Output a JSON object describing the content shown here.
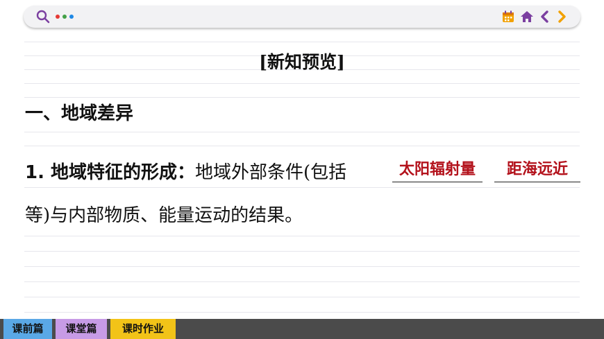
{
  "header": {
    "icons": [
      "search-icon",
      "more-dots-icon",
      "calendar-icon",
      "home-icon",
      "chevron-left-icon",
      "chevron-right-icon"
    ],
    "dot_colors": [
      "#e53935",
      "#43a047",
      "#1e88e5"
    ]
  },
  "content": {
    "section_title": "[新知预览]",
    "heading": "一、地域差异",
    "item1_lead": "1. 地域特征的形成：",
    "item1_text": "地域外部条件(包括",
    "blank1": "太阳辐射量",
    "blank2": "距海远近",
    "item1_cont": "等)与内部物质、能量运动的结果。"
  },
  "footer": {
    "tabs": [
      {
        "label": "课前篇",
        "color": "#5aa8e6"
      },
      {
        "label": "课堂篇",
        "color": "#c79be6"
      },
      {
        "label": "课时作业",
        "color": "#f2c318"
      }
    ]
  },
  "colors": {
    "answer": "#b3111b",
    "accent_purple": "#7b3fa0",
    "accent_orange": "#f2a100"
  }
}
